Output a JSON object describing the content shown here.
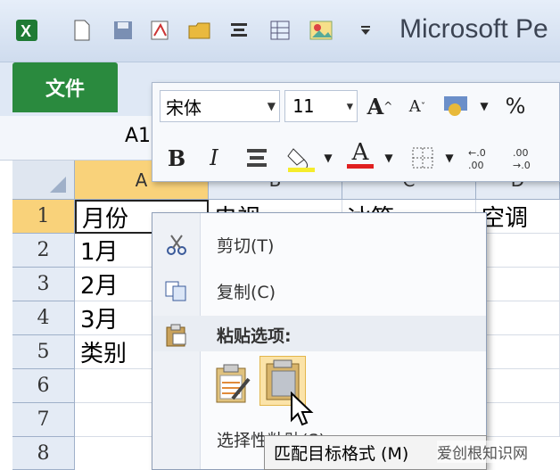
{
  "window": {
    "title": "Microsoft Pe"
  },
  "ribbon": {
    "file_tab": "文件"
  },
  "formula_bar": {
    "name_box": "A1"
  },
  "mini_toolbar": {
    "font_name": "宋体",
    "font_size": "11",
    "grow_font": "A",
    "shrink_font": "A",
    "percent": "%",
    "bold": "B",
    "italic": "I",
    "font_color_label": "A"
  },
  "grid": {
    "columns": [
      "A",
      "B",
      "C",
      "D"
    ],
    "rows": [
      "1",
      "2",
      "3",
      "4",
      "5",
      "6",
      "7",
      "8"
    ],
    "cells": {
      "A1": "月份",
      "B1": "电视",
      "C1": "冰箱",
      "D1": "空调",
      "A2": "1月",
      "A3": "2月",
      "A4": "3月",
      "A5": "类别"
    }
  },
  "context_menu": {
    "cut": "剪切(T)",
    "copy": "复制(C)",
    "paste_options": "粘贴选项:",
    "paste_special": "选择性粘贴(S)..."
  },
  "tooltip": {
    "text": "匹配目标格式 (M)"
  },
  "watermark": {
    "text": "爱创根知识网"
  },
  "colors": {
    "file_tab": "#2a8a3e",
    "selected_header": "#f9d27a",
    "font_color_bar": "#e02020"
  }
}
